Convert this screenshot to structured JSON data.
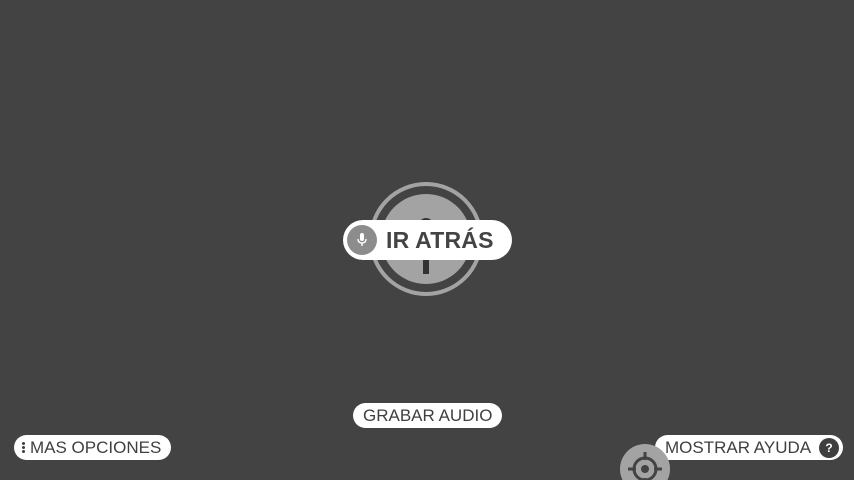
{
  "center": {
    "command_label": "IR ATRÁS",
    "mic_icon": "microphone-icon",
    "target_icon": "keyhole-icon"
  },
  "controls": {
    "record_audio_label": "GRABAR AUDIO",
    "more_options_label": "MAS OPCIONES",
    "more_options_icon": "vertical-dots-icon",
    "show_help_label": "MOSTRAR AYUDA",
    "help_icon_glyph": "?",
    "crosshair_icon": "crosshair-icon"
  },
  "colors": {
    "background": "#434343",
    "pill_background": "#ffffff",
    "target_gray": "#a3a3a3",
    "text_dark": "#3f3f3f"
  }
}
